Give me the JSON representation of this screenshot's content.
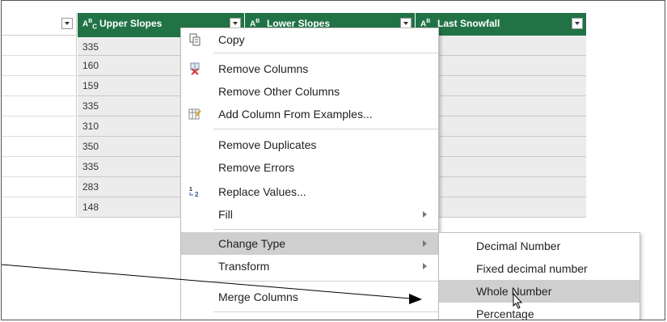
{
  "columns": [
    {
      "type_icon": "ABC",
      "title": ""
    },
    {
      "type_icon": "ABC",
      "title": "Upper Slopes"
    },
    {
      "type_icon": "AB",
      "title": "Lower Slopes"
    },
    {
      "type_icon": "AB",
      "title": "Last Snowfall"
    }
  ],
  "upper_slopes_values": [
    "335",
    "160",
    "159",
    "335",
    "310",
    "350",
    "335",
    "283",
    "148"
  ],
  "context_menu": {
    "items": [
      {
        "label": "Copy",
        "icon": "copy-icon"
      },
      {
        "label": "Remove Columns",
        "icon": "remove-columns-icon"
      },
      {
        "label": "Remove Other Columns",
        "icon": ""
      },
      {
        "label": "Add Column From Examples...",
        "icon": "add-column-examples-icon"
      },
      {
        "label": "Remove Duplicates",
        "icon": ""
      },
      {
        "label": "Remove Errors",
        "icon": ""
      },
      {
        "label": "Replace Values...",
        "icon": "replace-values-icon"
      },
      {
        "label": "Fill",
        "icon": "",
        "submenu": true
      },
      {
        "label": "Change Type",
        "icon": "",
        "submenu": true,
        "highlighted": true
      },
      {
        "label": "Transform",
        "icon": "",
        "submenu": true
      },
      {
        "label": "Merge Columns",
        "icon": ""
      }
    ]
  },
  "change_type_submenu": {
    "items": [
      {
        "label": "Decimal Number"
      },
      {
        "label": "Fixed decimal number"
      },
      {
        "label": "Whole Number",
        "highlighted": true
      },
      {
        "label": "Percentage"
      }
    ]
  },
  "colors": {
    "header_green": "#217346",
    "highlight": "#cfcfcf"
  }
}
